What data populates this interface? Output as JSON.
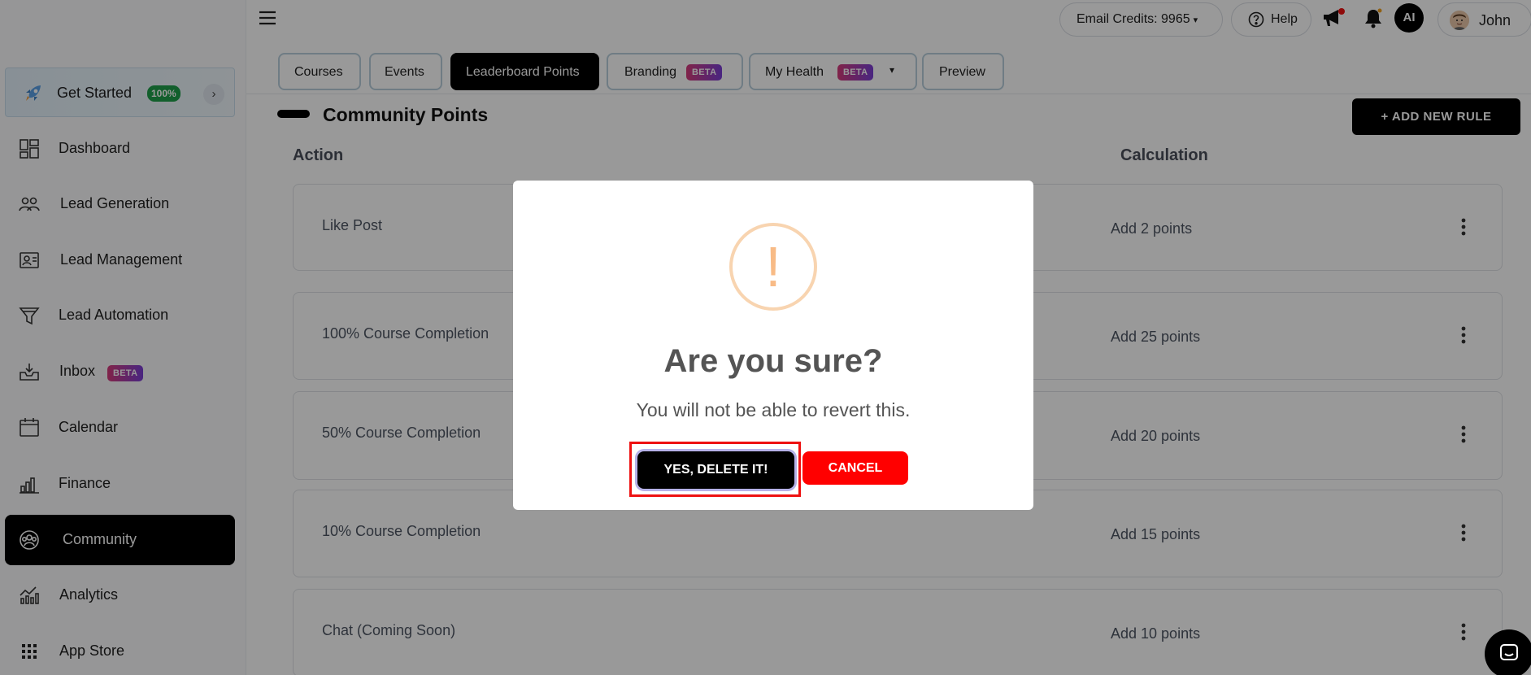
{
  "sidebar": {
    "get_started": {
      "label": "Get Started",
      "progress": "100%",
      "chevron": "›"
    },
    "items": [
      {
        "label": "Dashboard",
        "icon": "dashboard-icon"
      },
      {
        "label": "Lead Generation",
        "icon": "users-group-icon"
      },
      {
        "label": "Lead Management",
        "icon": "contact-card-icon"
      },
      {
        "label": "Lead Automation",
        "icon": "funnel-icon"
      },
      {
        "label": "Inbox",
        "icon": "inbox-icon",
        "badge": "BETA"
      },
      {
        "label": "Calendar",
        "icon": "calendar-icon"
      },
      {
        "label": "Finance",
        "icon": "bar-chart-icon"
      },
      {
        "label": "Community",
        "icon": "community-icon",
        "active": true
      },
      {
        "label": "Analytics",
        "icon": "analytics-icon"
      },
      {
        "label": "App Store",
        "icon": "grid-icon"
      }
    ]
  },
  "topbar": {
    "email_credits": "Email Credits: 9965",
    "help": "Help",
    "ai_avatar": "AI",
    "user_name": "John"
  },
  "tabs": [
    {
      "label": "Courses"
    },
    {
      "label": "Events"
    },
    {
      "label": "Leaderboard Points",
      "active": true
    },
    {
      "label": "Branding",
      "badge": "BETA"
    },
    {
      "label": "My Health",
      "badge": "BETA",
      "dropdown": true
    },
    {
      "label": "Preview"
    }
  ],
  "content": {
    "title": "Community Points",
    "add_rule_button": "+ ADD NEW RULE",
    "columns": {
      "action": "Action",
      "calculation": "Calculation"
    },
    "rows": [
      {
        "action": "Like Post",
        "calculation": "Add 2 points"
      },
      {
        "action": "100% Course Completion",
        "calculation": "Add 25 points"
      },
      {
        "action": "50% Course Completion",
        "calculation": "Add 20 points"
      },
      {
        "action": "10% Course Completion",
        "calculation": "Add 15 points"
      },
      {
        "action": "Chat (Coming Soon)",
        "calculation": "Add 10 points"
      }
    ]
  },
  "modal": {
    "icon": "exclamation-icon",
    "icon_glyph": "!",
    "title": "Are you sure?",
    "text": "You will not be able to revert this.",
    "confirm_button": "YES, DELETE IT!",
    "cancel_button": "CANCEL"
  },
  "colors": {
    "accent": "#000000",
    "beta_gradient_start": "#d63b7a",
    "beta_gradient_end": "#7a3fd6",
    "progress_badge": "#1f9e4a",
    "warning_icon": "#f8bb86",
    "cancel": "#ff0000",
    "highlight_outline": "#ee1111"
  }
}
